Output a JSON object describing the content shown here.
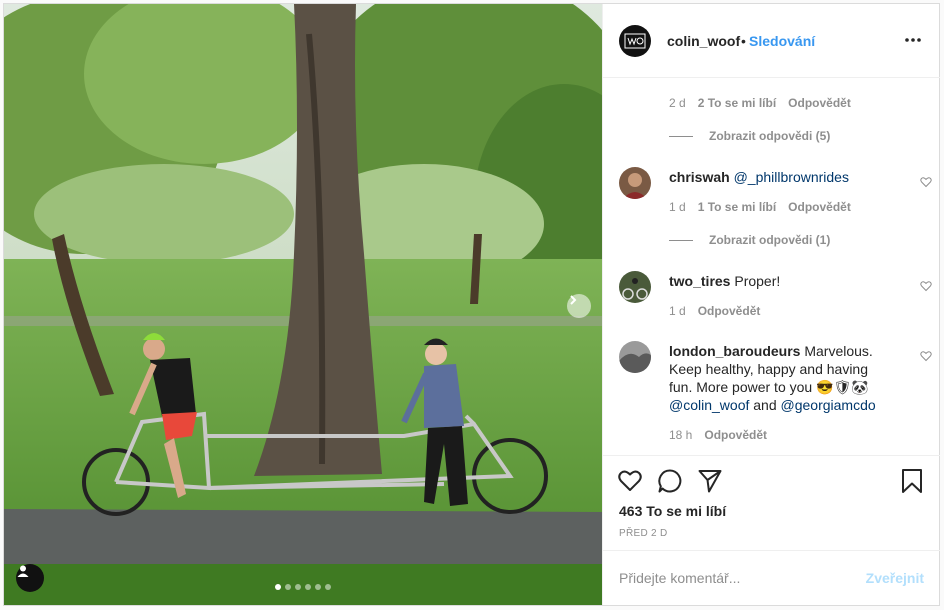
{
  "header": {
    "username": "colin_woof",
    "separator": "•",
    "follow_label": "Sledování",
    "more_icon": "more-horizontal-icon"
  },
  "thread": {
    "prev_meta": {
      "time": "2 d",
      "likes": "2 To se mi líbí",
      "reply": "Odpovědět"
    },
    "view_replies_1": "Zobrazit odpovědi (5)",
    "view_replies_2": "Zobrazit odpovědi (1)"
  },
  "comments": [
    {
      "user": "chriswah",
      "text": "",
      "mention": "@_phillbrownrides",
      "time": "1 d",
      "likes": "1 To se mi líbí",
      "reply": "Odpovědět"
    },
    {
      "user": "two_tires",
      "text": "Proper!",
      "time": "1 d",
      "reply": "Odpovědět"
    },
    {
      "user": "london_baroudeurs",
      "text": "Marvelous. Keep healthy, happy and having fun. More power to you 😎🛡🐼",
      "mention1": "@colin_woof",
      "joiner": "and",
      "mention2": "@georgiamcdo",
      "time": "18 h",
      "reply": "Odpovědět"
    }
  ],
  "actions": {
    "likes": "463 To se mi líbí",
    "posted": "PŘED 2 D"
  },
  "composer": {
    "placeholder": "Přidejte komentář...",
    "post_label": "Zveřejnit"
  },
  "carousel": {
    "count": 6,
    "active": 1
  },
  "colors": {
    "accent": "#3897f0",
    "link": "#00376b",
    "muted": "#8e8e8e",
    "post_disabled": "#b2dffc"
  }
}
